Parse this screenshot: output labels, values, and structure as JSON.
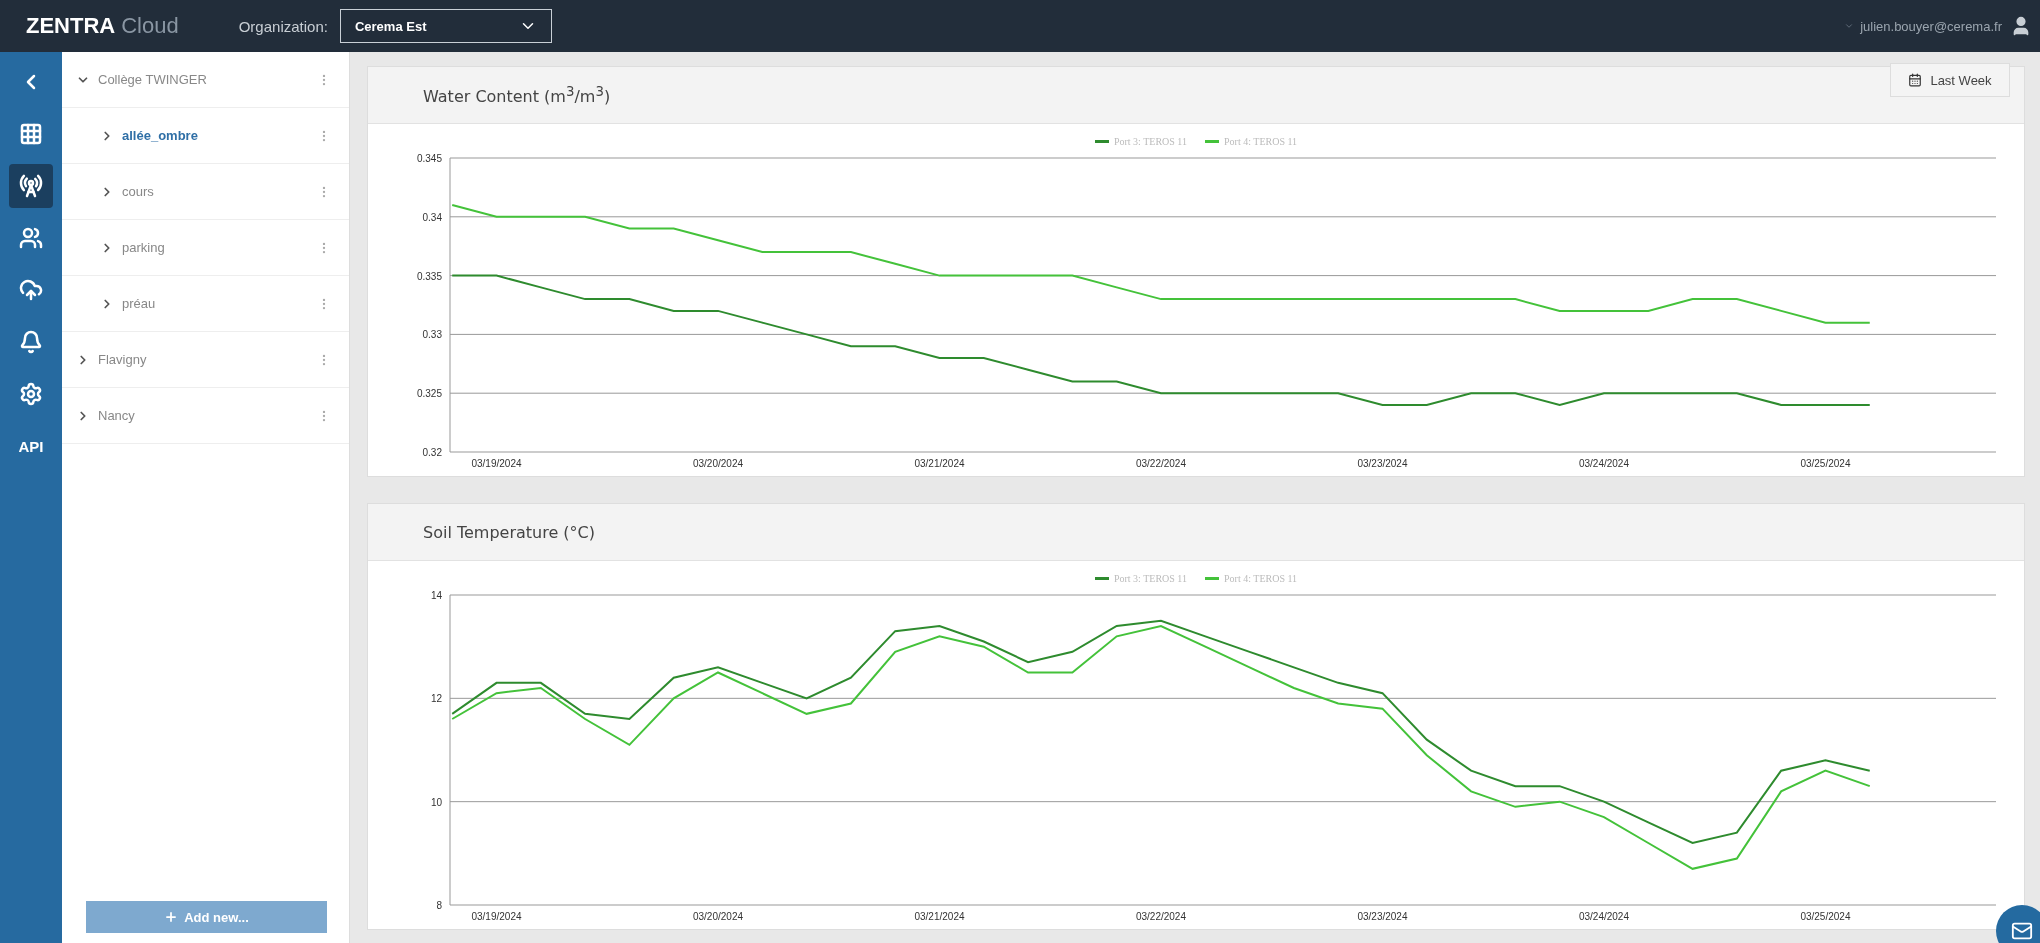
{
  "topbar": {
    "brand": "ZENTRA",
    "brand_suffix": "Cloud",
    "org_label": "Organization:",
    "org_value": "Cerema Est",
    "user_email": "julien.bouyer@cerema.fr"
  },
  "nav": {
    "items": [
      {
        "selected": false
      },
      {
        "selected": false
      },
      {
        "selected": true
      },
      {
        "selected": false
      },
      {
        "selected": false
      },
      {
        "selected": false
      },
      {
        "selected": false
      },
      {
        "selected": false,
        "label": "API"
      }
    ]
  },
  "tree": {
    "items": [
      {
        "label": "Collège TWINGER",
        "expanded": true,
        "selected": false,
        "children": [
          {
            "label": "allée_ombre",
            "expanded": false,
            "selected": true
          },
          {
            "label": "cours",
            "expanded": false,
            "selected": false
          },
          {
            "label": "parking",
            "expanded": false,
            "selected": false
          },
          {
            "label": "préau",
            "expanded": false,
            "selected": false
          }
        ]
      },
      {
        "label": "Flavigny",
        "expanded": false,
        "selected": false
      },
      {
        "label": "Nancy",
        "expanded": false,
        "selected": false
      }
    ],
    "add_button": "Add new..."
  },
  "cards": [
    {
      "title": "Water Content (m$^{3}$/m$^{3}$)",
      "range_button": "Last Week",
      "chart_data": {
        "type": "line",
        "grid": true,
        "categories": [
          null,
          "03/19/2024",
          null,
          null,
          null,
          null,
          "03/20/2024",
          null,
          null,
          null,
          null,
          "03/21/2024",
          null,
          null,
          null,
          null,
          "03/22/2024",
          null,
          null,
          null,
          null,
          "03/23/2024",
          null,
          null,
          null,
          null,
          "03/24/2024",
          null,
          null,
          null,
          null,
          "03/25/2024",
          null
        ],
        "ylim": [
          0.32,
          0.345
        ],
        "yticks": [
          0.32,
          0.325,
          0.33,
          0.335,
          0.34,
          0.345
        ],
        "series": [
          {
            "name": "Port 3: TEROS 11",
            "color": "#2e8b2e",
            "values": [
              0.335,
              0.335,
              0.334,
              0.333,
              0.333,
              0.332,
              0.332,
              0.331,
              0.33,
              0.329,
              0.329,
              0.328,
              0.328,
              0.327,
              0.326,
              0.326,
              0.325,
              0.325,
              0.325,
              0.325,
              0.325,
              0.324,
              0.324,
              0.325,
              0.325,
              0.324,
              0.325,
              0.325,
              0.325,
              0.325,
              0.324,
              0.324,
              0.324
            ]
          },
          {
            "name": "Port 4: TEROS 11",
            "color": "#44c23a",
            "values": [
              0.341,
              0.34,
              0.34,
              0.34,
              0.339,
              0.339,
              0.338,
              0.337,
              0.337,
              0.337,
              0.336,
              0.335,
              0.335,
              0.335,
              0.335,
              0.334,
              0.333,
              0.333,
              0.333,
              0.333,
              0.333,
              0.333,
              0.333,
              0.333,
              0.333,
              0.332,
              0.332,
              0.332,
              0.333,
              0.333,
              0.332,
              0.331,
              0.331
            ]
          }
        ]
      }
    },
    {
      "title": "Soil Temperature (°C)",
      "chart_data": {
        "type": "line",
        "grid": true,
        "categories": [
          null,
          "03/19/2024",
          null,
          null,
          null,
          null,
          "03/20/2024",
          null,
          null,
          null,
          null,
          "03/21/2024",
          null,
          null,
          null,
          null,
          "03/22/2024",
          null,
          null,
          null,
          null,
          "03/23/2024",
          null,
          null,
          null,
          null,
          "03/24/2024",
          null,
          null,
          null,
          null,
          "03/25/2024",
          null
        ],
        "ylim": [
          8,
          14
        ],
        "yticks": [
          8,
          10,
          12,
          14
        ],
        "series": [
          {
            "name": "Port 3: TEROS 11",
            "color": "#2e8b2e",
            "values": [
              11.7,
              12.3,
              12.3,
              11.7,
              11.6,
              12.4,
              12.6,
              12.3,
              12,
              12.4,
              13.3,
              13.4,
              13.1,
              12.7,
              12.9,
              13.4,
              13.5,
              13.2,
              12.9,
              12.6,
              12.3,
              12.1,
              11.2,
              10.6,
              10.3,
              10.3,
              10,
              9.6,
              9.2,
              9.4,
              10.6,
              10.8,
              10.6
            ]
          },
          {
            "name": "Port 4: TEROS 11",
            "color": "#44c23a",
            "values": [
              11.6,
              12.1,
              12.2,
              11.6,
              11.1,
              12,
              12.5,
              12.1,
              11.7,
              11.9,
              12.9,
              13.2,
              13,
              12.5,
              12.5,
              13.2,
              13.4,
              13,
              12.6,
              12.2,
              11.9,
              11.8,
              10.9,
              10.2,
              9.9,
              10,
              9.7,
              9.2,
              8.7,
              8.9,
              10.2,
              10.6,
              10.3
            ]
          }
        ]
      }
    }
  ]
}
